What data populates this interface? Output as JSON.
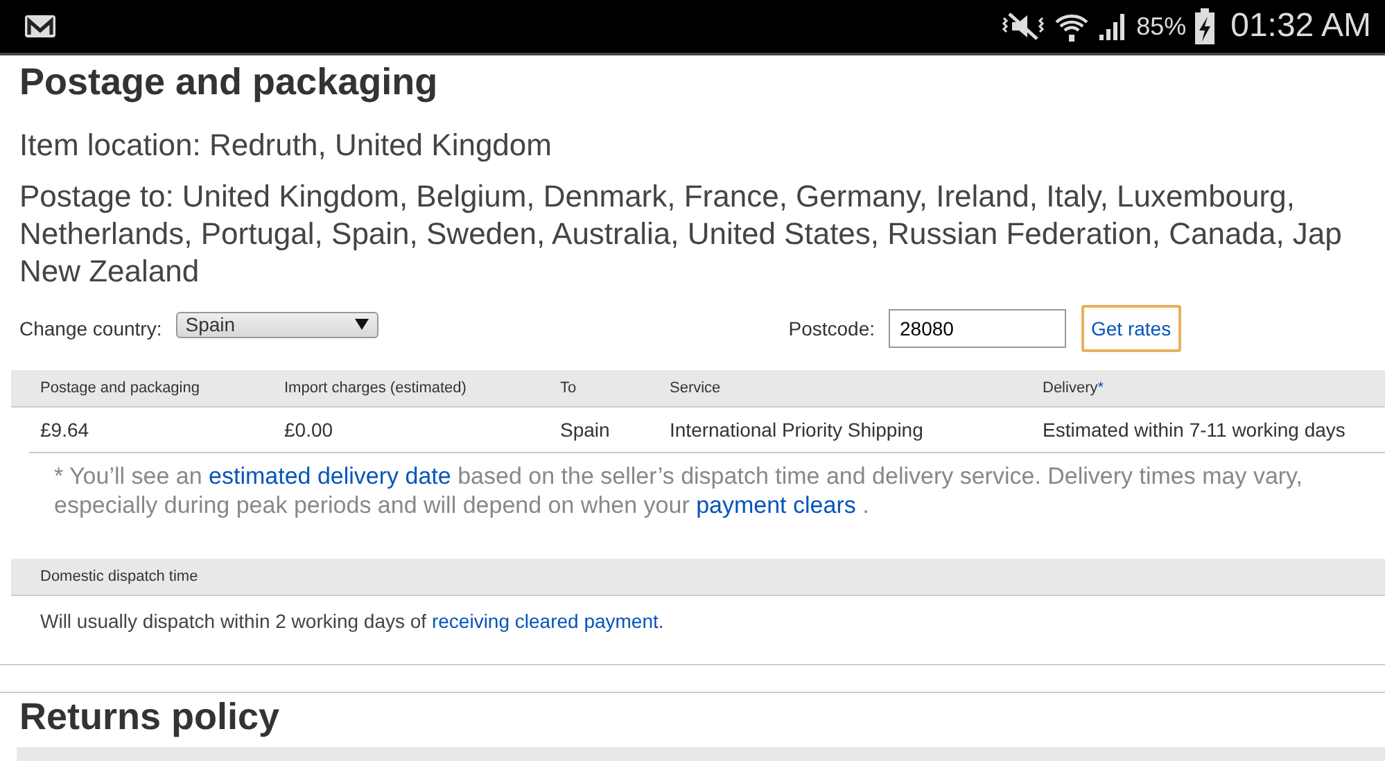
{
  "status_bar": {
    "battery": "85%",
    "time": "01:32 AM"
  },
  "title": "Postage and packaging",
  "item_location": "Item location: Redruth, United Kingdom",
  "postage_to": [
    "Postage to: United Kingdom, Belgium, Denmark, France, Germany, Ireland, Italy, Luxembourg,",
    "Netherlands, Portugal, Spain, Sweden, Australia, United States, Russian Federation, Canada, Jap",
    "New Zealand"
  ],
  "country": {
    "label": "Change country:",
    "value": "Spain"
  },
  "postcode": {
    "label": "Postcode:",
    "value": "28080"
  },
  "get_rates_button": "Get rates",
  "table": {
    "columns": [
      {
        "label": "Postage and packaging"
      },
      {
        "label": "Import charges (estimated)"
      },
      {
        "label": "To"
      },
      {
        "label": "Service"
      },
      {
        "label": "Delivery",
        "mark": "*"
      }
    ],
    "rows": [
      [
        "£9.64",
        "£0.00",
        "Spain",
        "International Priority Shipping",
        "Estimated within 7-11 working days"
      ]
    ]
  },
  "note": [
    {
      "text": "* You’ll see an ",
      "link": false
    },
    {
      "text": "estimated delivery date",
      "link": true
    },
    {
      "text": " based on the seller’s dispatch time and delivery service. Delivery times may vary, especially during peak periods and will depend on when your ",
      "link": false
    },
    {
      "text": "payment clears",
      "link": true
    },
    {
      "text": " .",
      "link": false
    }
  ],
  "dispatch": {
    "heading": "Domestic dispatch time",
    "text": [
      {
        "text": "Will usually dispatch within 2 working days of ",
        "link": false
      },
      {
        "text": "receiving cleared payment",
        "link": true
      },
      {
        "text": ".",
        "link": false
      }
    ]
  },
  "returns_title": "Returns policy"
}
